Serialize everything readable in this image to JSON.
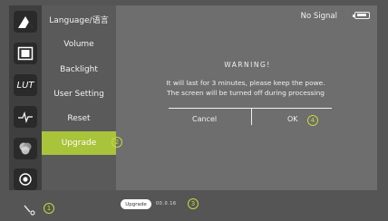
{
  "status": {
    "signal_text": "No Signal",
    "battery_icon": "battery-icon"
  },
  "icon_rail": [
    {
      "name": "logo-icon"
    },
    {
      "name": "frame-icon"
    },
    {
      "name": "lut-icon",
      "text": "LUT"
    },
    {
      "name": "waveform-icon"
    },
    {
      "name": "color-circles-icon"
    },
    {
      "name": "record-icon"
    }
  ],
  "menu": {
    "items": [
      {
        "label": "Language/语言"
      },
      {
        "label": "Volume"
      },
      {
        "label": "Backlight"
      },
      {
        "label": "User Setting"
      },
      {
        "label": "Reset"
      },
      {
        "label": "Upgrade"
      }
    ],
    "selected": "Upgrade",
    "accent_color": "#a9c33a"
  },
  "dialog": {
    "title": "WARNING!",
    "line1": "It will last for 3 minutes, please keep the powe.",
    "line2": "The screen will be turned off during processing",
    "cancel_label": "Cancel",
    "ok_label": "OK"
  },
  "annotations": {
    "b1": "1",
    "b2": "2",
    "b3": "3",
    "b4": "4",
    "color": "#c8d83a"
  },
  "bottom": {
    "upgrade_label": "Upgrade",
    "version": "00.0.16"
  }
}
